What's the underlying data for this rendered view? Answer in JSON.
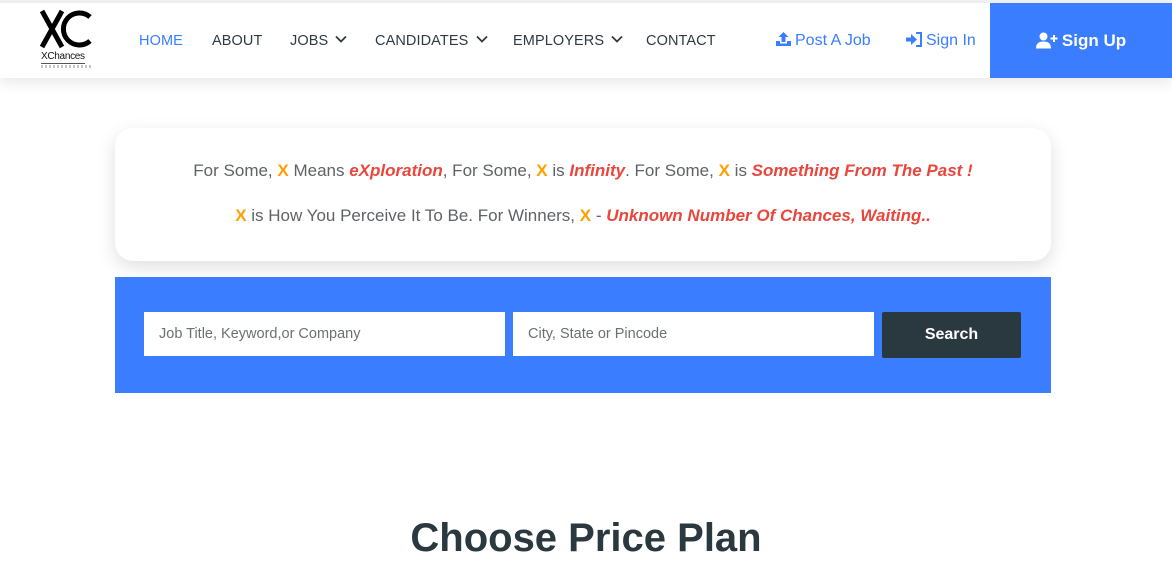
{
  "brand": {
    "logo_mark": "XC",
    "logo_word": "XChances"
  },
  "nav": {
    "items": [
      {
        "label": "HOME",
        "active": true,
        "dropdown": false
      },
      {
        "label": "ABOUT",
        "active": false,
        "dropdown": false
      },
      {
        "label": "JOBS",
        "active": false,
        "dropdown": true
      },
      {
        "label": "CANDIDATES",
        "active": false,
        "dropdown": true
      },
      {
        "label": "EMPLOYERS",
        "active": false,
        "dropdown": true
      },
      {
        "label": "CONTACT",
        "active": false,
        "dropdown": false
      }
    ],
    "post_job": {
      "label": "Post A Job",
      "icon": "upload-icon"
    },
    "sign_in": {
      "label": "Sign In",
      "icon": "sign-in-icon"
    },
    "sign_up": {
      "label": "Sign Up",
      "icon": "user-plus-icon"
    }
  },
  "quote": {
    "line1": {
      "p1": "For Some, ",
      "x1": "X",
      "p2": " Means ",
      "e1": "eXploration",
      "p3": ", For Some, ",
      "x2": "X",
      "p4": " is ",
      "e2": "Infinity",
      "p5": ". For Some, ",
      "x3": "X",
      "p6": " is ",
      "e3": "Something From The Past !"
    },
    "line2": {
      "x1": "X",
      "p1": " is How You Perceive It To Be. For Winners, ",
      "x2": "X",
      "p2": " - ",
      "e1": "Unknown Number Of Chances, Waiting.."
    }
  },
  "search": {
    "keyword_placeholder": "Job Title, Keyword,or Company",
    "keyword_value": "",
    "location_placeholder": "City, State or Pincode",
    "location_value": "",
    "button_label": "Search"
  },
  "pricing": {
    "title": "Choose Price Plan"
  },
  "colors": {
    "accent": "#3a7dff",
    "highlight_x": "#ff9f00",
    "emphasis": "#e9463c",
    "dark": "#2a3940"
  }
}
